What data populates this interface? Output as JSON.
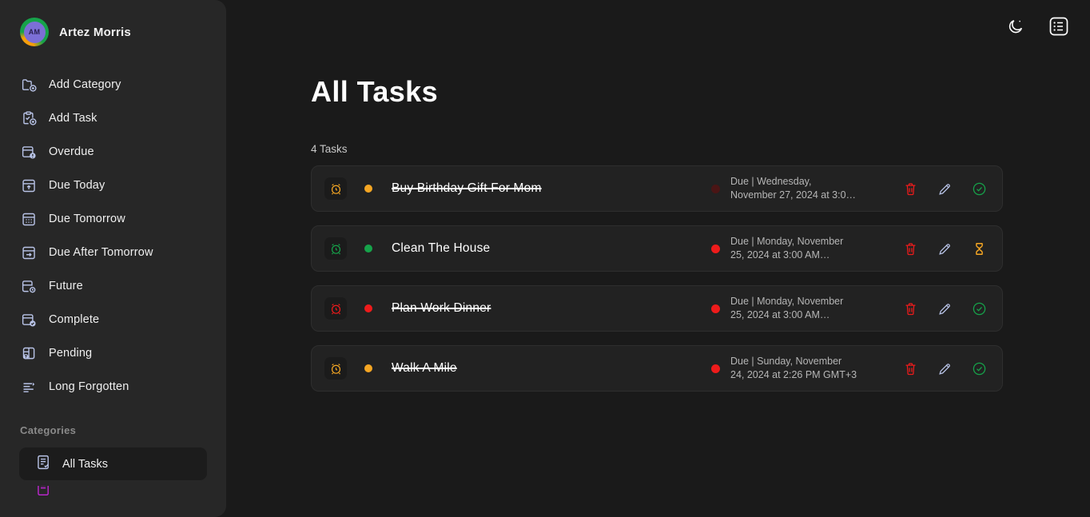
{
  "colors": {
    "page_bg": "#1a1a1a",
    "sidebar_bg": "#272727",
    "row_bg": "#222222",
    "accent_orange": "#f5a623",
    "accent_green": "#16a34a",
    "accent_red": "#ee1b1b",
    "accent_blue": "#b9c4e8",
    "avatar_purple": "#7c6fd6",
    "category_purple": "#c026d3"
  },
  "sidebar": {
    "profile": {
      "initials": "AM",
      "name": "Artez Morris"
    },
    "items": [
      {
        "label": "Add Category",
        "icon": "folder-plus-icon"
      },
      {
        "label": "Add Task",
        "icon": "clipboard-check-plus-icon"
      },
      {
        "label": "Overdue",
        "icon": "calendar-alert-icon"
      },
      {
        "label": "Due Today",
        "icon": "calendar-arrow-up-icon"
      },
      {
        "label": "Due Tomorrow",
        "icon": "calendar-dots-icon"
      },
      {
        "label": "Due After Tomorrow",
        "icon": "calendar-arrow-right-icon"
      },
      {
        "label": "Future",
        "icon": "calendar-clock-icon"
      },
      {
        "label": "Complete",
        "icon": "calendar-check-icon"
      },
      {
        "label": "Pending",
        "icon": "calendar-question-icon"
      },
      {
        "label": "Long Forgotten",
        "icon": "list-lines-icon"
      }
    ],
    "categories_heading": "Categories",
    "categories": [
      {
        "label": "All Tasks",
        "icon": "list-check-icon",
        "active": true
      }
    ]
  },
  "topbar": {
    "theme_toggle": "moon-icon",
    "list_view": "list-square-icon"
  },
  "main": {
    "title": "All Tasks",
    "count_label": "4 Tasks",
    "tasks": [
      {
        "title": "Buy Birthday Gift For Mom",
        "completed": true,
        "alarm_color": "#f5a623",
        "priority_color": "#f5a623",
        "due_dot_color": "#4a1515",
        "due_line1": "Due | Wednesday,",
        "due_line2": "November 27, 2024 at 3:0…",
        "actions": [
          "delete-icon",
          "edit-icon",
          "check-circle-icon"
        ],
        "status_icon": "check-circle-icon"
      },
      {
        "title": "Clean The House",
        "completed": false,
        "alarm_color": "#16a34a",
        "priority_color": "#16a34a",
        "due_dot_color": "#ee1b1b",
        "due_line1": "Due | Monday, November",
        "due_line2": "25, 2024 at 3:00 AM…",
        "actions": [
          "delete-icon",
          "edit-icon",
          "hourglass-icon"
        ],
        "status_icon": "hourglass-icon"
      },
      {
        "title": "Plan Work Dinner",
        "completed": true,
        "alarm_color": "#ee1b1b",
        "priority_color": "#ee1b1b",
        "due_dot_color": "#ee1b1b",
        "due_line1": "Due | Monday, November",
        "due_line2": "25, 2024 at 3:00 AM…",
        "actions": [
          "delete-icon",
          "edit-icon",
          "check-circle-icon"
        ],
        "status_icon": "check-circle-icon"
      },
      {
        "title": "Walk A Mile",
        "completed": true,
        "alarm_color": "#f5a623",
        "priority_color": "#f5a623",
        "due_dot_color": "#ee1b1b",
        "due_line1": "Due | Sunday, November",
        "due_line2": "24, 2024 at 2:26 PM GMT+3",
        "actions": [
          "delete-icon",
          "edit-icon",
          "check-circle-icon"
        ],
        "status_icon": "check-circle-icon"
      }
    ]
  }
}
